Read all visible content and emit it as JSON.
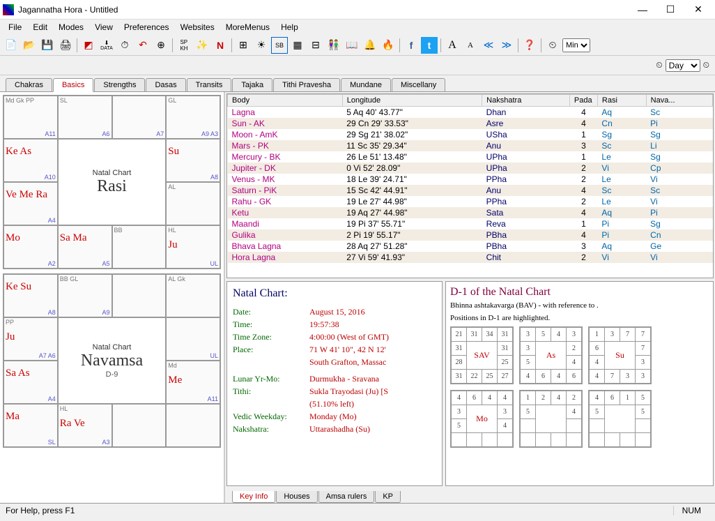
{
  "window": {
    "title": "Jagannatha Hora - Untitled",
    "minimize": "—",
    "maximize": "☐",
    "close": "✕"
  },
  "menu": [
    "File",
    "Edit",
    "Modes",
    "View",
    "Preferences",
    "Websites",
    "MoreMenus",
    "Help"
  ],
  "toolbar_select": "Min",
  "toolbar2_select": "Day",
  "tabs": [
    "Chakras",
    "Basics",
    "Strengths",
    "Dasas",
    "Transits",
    "Tajaka",
    "Tithi Pravesha",
    "Mundane",
    "Miscellany"
  ],
  "tabs_active": 1,
  "charts": {
    "rasi": {
      "title": "Natal Chart",
      "name": "Rasi",
      "sub": "",
      "cells": [
        {
          "upagr": "Md   Gk    PP",
          "planets": "",
          "nums": "A11"
        },
        {
          "upagr": "SL",
          "planets": "",
          "nums": "A6"
        },
        {
          "upagr": "",
          "planets": "",
          "nums": "A7"
        },
        {
          "upagr": "GL",
          "planets": "",
          "nums": "A9 A3"
        },
        {
          "upagr": "",
          "planets": "Ke As",
          "nums": "A10"
        },
        {
          "upagr": "",
          "planets": "Su",
          "nums": "A8"
        },
        {
          "upagr": "AL",
          "planets": "",
          "nums": ""
        },
        {
          "upagr": "",
          "planets": "Ve Me Ra",
          "nums": "A4"
        },
        {
          "upagr": "",
          "planets": "Mo",
          "nums": "A2"
        },
        {
          "upagr": "",
          "planets": "Sa Ma",
          "nums": "A5"
        },
        {
          "upagr": "BB",
          "planets": "",
          "nums": ""
        },
        {
          "upagr": "HL",
          "planets": "Ju",
          "nums": "UL"
        }
      ]
    },
    "navamsa": {
      "title": "Natal Chart",
      "name": "Navamsa",
      "sub": "D-9",
      "cells": [
        {
          "upagr": "",
          "planets": "Ke Su",
          "nums": "A8"
        },
        {
          "upagr": "BB   GL",
          "planets": "",
          "nums": "A9"
        },
        {
          "upagr": "",
          "planets": "",
          "nums": ""
        },
        {
          "upagr": "AL   Gk",
          "planets": "",
          "nums": ""
        },
        {
          "upagr": "PP",
          "planets": "Ju",
          "nums": "A7 A6"
        },
        {
          "upagr": "",
          "planets": "",
          "nums": "UL"
        },
        {
          "upagr": "Md",
          "planets": "Me",
          "nums": "A11"
        },
        {
          "upagr": "",
          "planets": "Sa As",
          "nums": "A4"
        },
        {
          "upagr": "",
          "planets": "Ma",
          "nums": "SL"
        },
        {
          "upagr": "HL",
          "planets": "Ra Ve",
          "nums": "A3"
        },
        {
          "upagr": "",
          "planets": "",
          "nums": ""
        },
        {
          "upagr": "",
          "planets": "",
          "nums": ""
        }
      ]
    }
  },
  "bodytable": {
    "headers": [
      "Body",
      "Longitude",
      "Nakshatra",
      "Pada",
      "Rasi",
      "Nava..."
    ],
    "rows": [
      [
        "Lagna",
        "5 Aq 40' 43.77\"",
        "Dhan",
        "4",
        "Aq",
        "Sc"
      ],
      [
        "Sun - AK",
        "29 Cn 29' 33.53\"",
        "Asre",
        "4",
        "Cn",
        "Pi"
      ],
      [
        "Moon - AmK",
        "29 Sg 21' 38.02\"",
        "USha",
        "1",
        "Sg",
        "Sg"
      ],
      [
        "Mars - PK",
        "11 Sc 35' 29.34\"",
        "Anu",
        "3",
        "Sc",
        "Li"
      ],
      [
        "Mercury - BK",
        "26 Le 51' 13.48\"",
        "UPha",
        "1",
        "Le",
        "Sg"
      ],
      [
        "Jupiter - DK",
        "0 Vi 52' 28.09\"",
        "UPha",
        "2",
        "Vi",
        "Cp"
      ],
      [
        "Venus - MK",
        "18 Le 39' 24.71\"",
        "PPha",
        "2",
        "Le",
        "Vi"
      ],
      [
        "Saturn - PiK",
        "15 Sc 42' 44.91\"",
        "Anu",
        "4",
        "Sc",
        "Sc"
      ],
      [
        "Rahu - GK",
        "19 Le 27' 44.98\"",
        "PPha",
        "2",
        "Le",
        "Vi"
      ],
      [
        "Ketu",
        "19 Aq 27' 44.98\"",
        "Sata",
        "4",
        "Aq",
        "Pi"
      ],
      [
        "Maandi",
        "19 Pi 37' 55.71\"",
        "Reva",
        "1",
        "Pi",
        "Sg"
      ],
      [
        "Gulika",
        "2 Pi 19' 55.17\"",
        "PBha",
        "4",
        "Pi",
        "Cn"
      ],
      [
        "Bhava Lagna",
        "28 Aq 27' 51.28\"",
        "PBha",
        "3",
        "Aq",
        "Ge"
      ],
      [
        "Hora Lagna",
        "27 Vi 59' 41.93\"",
        "Chit",
        "2",
        "Vi",
        "Vi"
      ]
    ]
  },
  "info": {
    "title": "Natal Chart:",
    "date_label": "Date:",
    "date": "August 15, 2016",
    "time_label": "Time:",
    "time": "19:57:38",
    "tz_label": "Time Zone:",
    "tz": "4:00:00 (West of GMT)",
    "place_label": "Place:",
    "place": "71 W 41' 10\", 42 N 12'",
    "place2": "South Grafton, Massac",
    "lunar_label": "Lunar Yr-Mo:",
    "lunar": "Durmukha - Sravana",
    "tithi_label": "Tithi:",
    "tithi": "Sukla Trayodasi (Ju) [S",
    "tithi2": "(51.10% left)",
    "weekday_label": "Vedic Weekday:",
    "weekday": "Monday (Mo)",
    "nak_label": "Nakshatra:",
    "nak": "Uttarashadha (Su)"
  },
  "bav": {
    "title": "D-1 of the Natal Chart",
    "desc": "Bhinna ashtakavarga (BAV) - with reference to .",
    "desc2": "Positions in D-1 are highlighted.",
    "charts": [
      {
        "label": "SAV",
        "cells": [
          [
            "21",
            "31",
            "34",
            "31"
          ],
          [
            "31",
            "",
            "",
            "31"
          ],
          [
            "28",
            "",
            "",
            "25"
          ],
          [
            "31",
            "22",
            "25",
            "27"
          ]
        ]
      },
      {
        "label": "As",
        "cells": [
          [
            "3",
            "5",
            "4",
            "3"
          ],
          [
            "3",
            "",
            "",
            "2"
          ],
          [
            "5",
            "",
            "",
            "4"
          ],
          [
            "4",
            "6",
            "4",
            "6"
          ]
        ],
        "planet": ""
      },
      {
        "label": "Su",
        "cells": [
          [
            "1",
            "3",
            "7",
            "7"
          ],
          [
            "6",
            "",
            "",
            "7"
          ],
          [
            "4",
            "",
            "",
            "3"
          ],
          [
            "4",
            "7",
            "3",
            "3"
          ]
        ],
        "planet": ""
      },
      {
        "label": "Mo",
        "cells": [
          [
            "4",
            "6",
            "4",
            "4"
          ],
          [
            "3",
            "",
            "",
            "3"
          ],
          [
            "5",
            "",
            "",
            "4"
          ],
          [
            "",
            "",
            "",
            ""
          ]
        ],
        "planet": ""
      },
      {
        "label": "",
        "cells": [
          [
            "1",
            "2",
            "4",
            "2"
          ],
          [
            "5",
            "",
            "",
            "4"
          ],
          [
            "",
            "",
            "",
            ""
          ],
          [
            "",
            "",
            "",
            ""
          ]
        ],
        "planet": ""
      },
      {
        "label": "",
        "cells": [
          [
            "4",
            "6",
            "1",
            "5"
          ],
          [
            "5",
            "",
            "",
            "5"
          ],
          [
            "",
            "",
            "",
            ""
          ],
          [
            "",
            "",
            "",
            ""
          ]
        ],
        "planet": ""
      }
    ]
  },
  "bottomtabs": [
    "Key Info",
    "Houses",
    "Amsa rulers",
    "KP"
  ],
  "bottomtabs_active": 0,
  "status": {
    "help": "For Help, press F1",
    "num": "NUM"
  }
}
